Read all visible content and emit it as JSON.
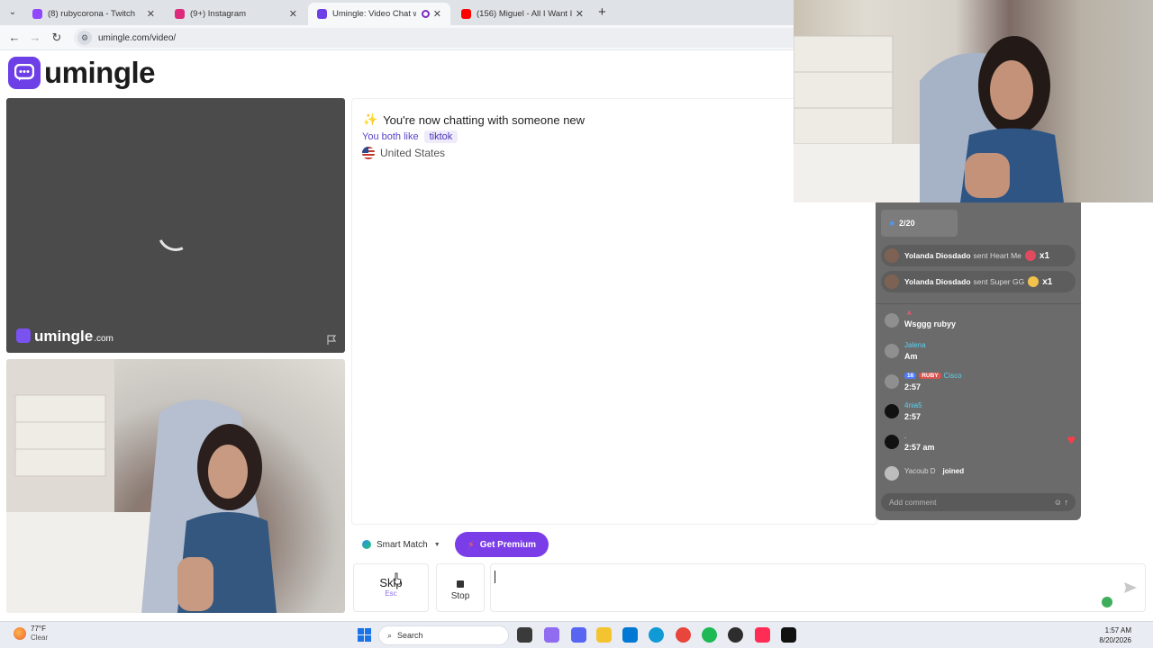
{
  "browser": {
    "tabs": [
      {
        "label": "(8) rubycorona - Twitch",
        "color": "#9146ff",
        "active": false
      },
      {
        "label": "(9+) Instagram",
        "color": "#dd2a7b",
        "active": false
      },
      {
        "label": "Umingle: Video Chat with S",
        "color": "#6d3fe6",
        "active": true
      },
      {
        "label": "(156) Miguel - All I Want Is You",
        "color": "#ff0000",
        "active": false
      }
    ],
    "tab_close": "✕",
    "new_tab": "+",
    "url": "umingle.com/video/"
  },
  "site": {
    "logo_text": "umingle",
    "brand_color": "#6d3fe6",
    "watermark": {
      "name": "umingle",
      "domain": ".com"
    },
    "chat": {
      "title": "You're now chatting with someone new",
      "common_label": "You both like",
      "interest": "tiktok",
      "country": "United States"
    },
    "smart_match": "Smart Match",
    "premium": "Get Premium",
    "skip": {
      "label": "Skip",
      "key": "Esc"
    },
    "stop": "Stop"
  },
  "stream_chat": {
    "goal": "2/20",
    "gifts": [
      {
        "user": "Yolanda Diosdado",
        "action": "sent Heart Me",
        "count": "x1",
        "icon_color": "#e04a5f"
      },
      {
        "user": "Yolanda Diosdado",
        "action": "sent Super GG",
        "count": "x1",
        "icon_color": "#f2c24b"
      }
    ],
    "messages": [
      {
        "user": "",
        "text": "Wsggg rubyy",
        "badge": "A",
        "heart": false
      },
      {
        "user": "Jalena",
        "text": "Am",
        "badge": "",
        "heart": false
      },
      {
        "user": "Cisco",
        "text": "2:57",
        "badge": "16",
        "badge2": "RUBY",
        "heart": false
      },
      {
        "user": "4nia5",
        "text": "2:57",
        "badge": "",
        "heart": false
      },
      {
        "user": ".",
        "text": "2:57 am",
        "badge": "",
        "heart": true
      }
    ],
    "joined": {
      "user": "Yacoub D",
      "action": "joined"
    },
    "add_comment": "Add comment"
  },
  "taskbar": {
    "temp": "77°F",
    "condition": "Clear",
    "search": "Search",
    "time": "1:57 AM",
    "date": "8/20/2026"
  }
}
